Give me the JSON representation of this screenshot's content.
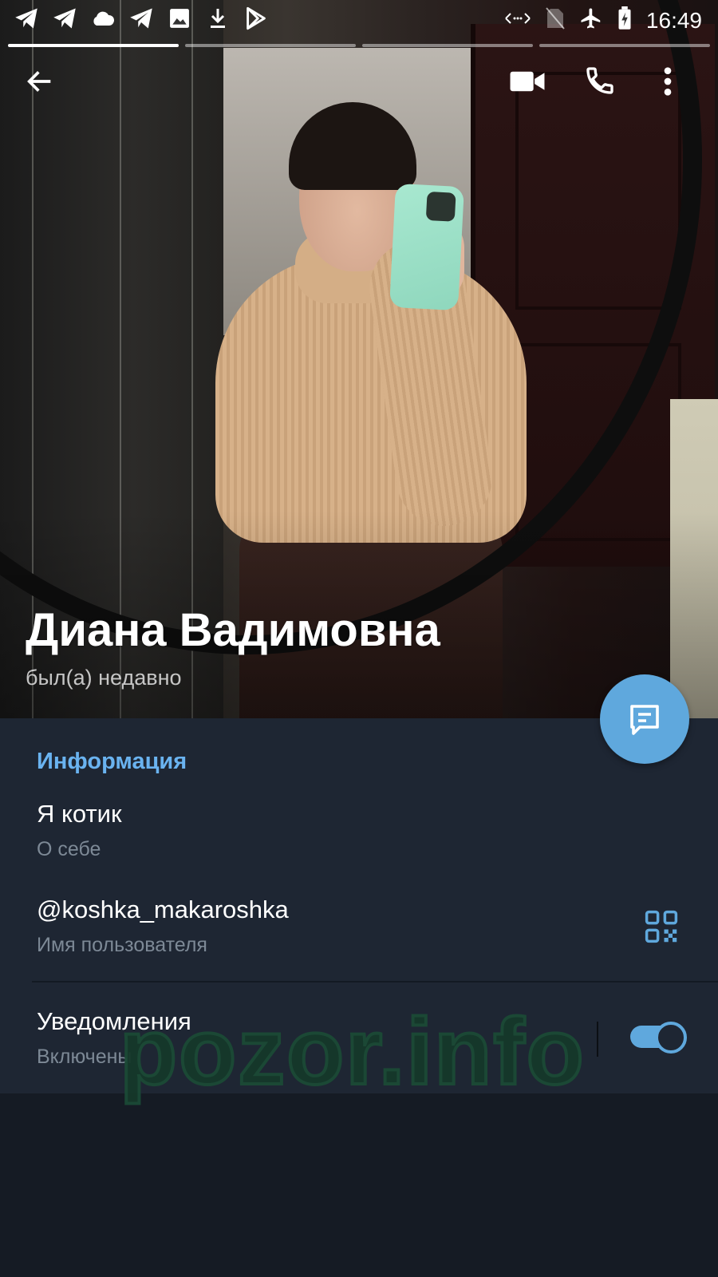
{
  "status_bar": {
    "time": "16:49",
    "left_icons": [
      "telegram-icon",
      "telegram-icon",
      "cloud-icon",
      "telegram-icon",
      "image-icon",
      "download-icon",
      "play-store-icon"
    ],
    "right_icons": [
      "data-arrows-icon",
      "no-sim-icon",
      "airplane-icon",
      "battery-charging-icon"
    ]
  },
  "stories": {
    "count": 4,
    "active_index": 0
  },
  "profile": {
    "name": "Диана Вадимовна",
    "status": "был(а) недавно"
  },
  "info": {
    "section_title": "Информация",
    "bio": {
      "value": "Я котик",
      "label": "О себе"
    },
    "username": {
      "value": "@koshka_makaroshka",
      "label": "Имя пользователя"
    },
    "notifications": {
      "value": "Уведомления",
      "label": "Включены",
      "enabled": true
    }
  },
  "watermark": "pozor.info",
  "colors": {
    "accent": "#5fa8dd",
    "section_title": "#6ab3f0",
    "panel_bg": "#1e2633",
    "page_bg": "#151b24"
  }
}
